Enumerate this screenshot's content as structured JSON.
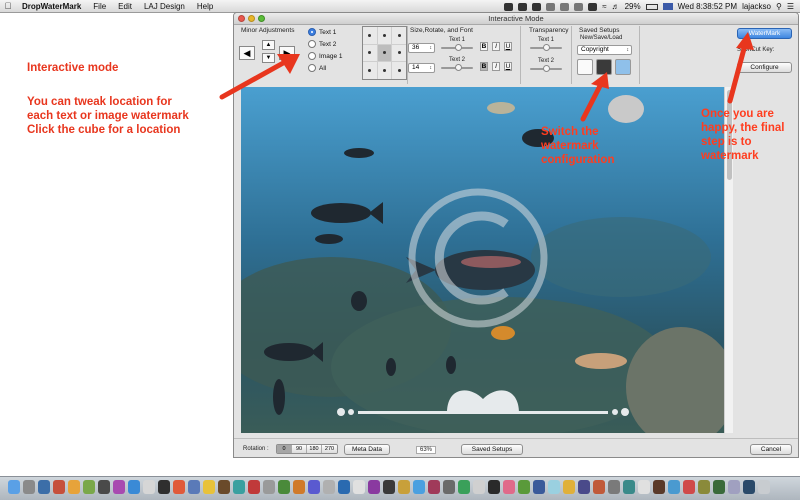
{
  "menubar": {
    "app_name": "DropWaterMark",
    "items": [
      "File",
      "Edit",
      "LAJ Design",
      "Help"
    ],
    "battery": "29%",
    "clock": "Wed 8:38:52 PM",
    "user": "lajackso"
  },
  "annotations": {
    "interactive": "Interactive mode",
    "tweak": [
      "You can tweak location for",
      "each text or image watermark",
      "Click the cube for a location"
    ],
    "switch": [
      "Switch the",
      "watermark",
      "configuration"
    ],
    "happy": [
      "Once you are",
      "happy, the final",
      "step is to",
      "watermark"
    ]
  },
  "window": {
    "title": "Interactive Mode",
    "minor_adjustments": "Minor Adjustments",
    "radios": [
      {
        "label": "Text 1",
        "selected": true
      },
      {
        "label": "Text 2",
        "selected": false
      },
      {
        "label": "Image 1",
        "selected": false
      },
      {
        "label": "All",
        "selected": false
      }
    ],
    "size_group": "Size,Rotate, and Font",
    "text1_label": "Text 1",
    "text2_label": "Text 2",
    "size1": "36",
    "size2": "14",
    "bold": "B",
    "italic": "I",
    "underline": "U",
    "transparency": "Transparency",
    "trans_text1": "Text 1",
    "trans_text2": "Text 2",
    "saved_setups_group": "Saved Setups",
    "new_save_load": "New/Save/Load",
    "setup_value": "Copyright",
    "watermark_button": "WaterMark",
    "shortcut_label": "ShortCut Key:",
    "configure_button": "Configure",
    "rotation_label": "Rotation :",
    "rotations": [
      "0",
      "90",
      "180",
      "270"
    ],
    "meta_data_button": "Meta Data",
    "zoom": "63%",
    "saved_setups_button": "Saved Setups",
    "cancel_button": "Cancel"
  },
  "slider_levels": {
    "text1": 0.55,
    "text2": 0.55,
    "trans1": 0.5,
    "trans2": 0.5
  }
}
